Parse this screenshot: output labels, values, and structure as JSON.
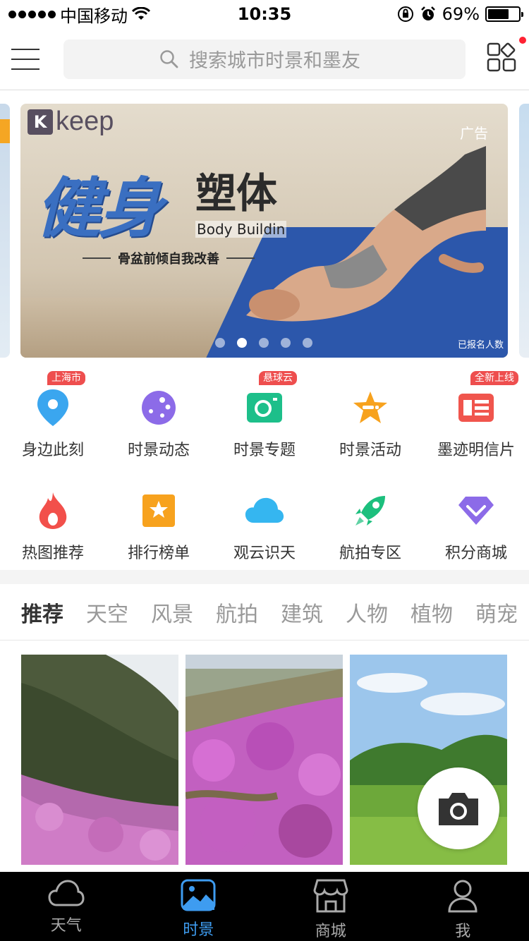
{
  "status_bar": {
    "carrier": "中国移动",
    "time": "10:35",
    "battery": "69%",
    "battery_level": 0.69
  },
  "header": {
    "search_placeholder": "搜索城市时景和墨友"
  },
  "banner": {
    "brand": "keep",
    "ad_tag": "广告",
    "headline_big": "健身",
    "headline_small": "塑体",
    "headline_en": "Body Buildin",
    "headline_sub": "骨盆前倾自我改善",
    "signup_text": "已报名人数",
    "page_count": 5,
    "active_page": 2
  },
  "features": [
    {
      "label": "身边此刻",
      "badge": "上海市",
      "icon": "location-pin-icon",
      "color": "#3aa6ef"
    },
    {
      "label": "时景动态",
      "badge": "",
      "icon": "palette-icon",
      "color": "#8c6be8"
    },
    {
      "label": "时景专题",
      "badge": "悬球云",
      "icon": "camera-square-icon",
      "color": "#1dbf8a"
    },
    {
      "label": "时景活动",
      "badge": "",
      "icon": "star-ticket-icon",
      "color": "#f7a21e"
    },
    {
      "label": "墨迹明信片",
      "badge": "全新上线",
      "icon": "postcard-icon",
      "color": "#f0554d"
    },
    {
      "label": "热图推荐",
      "badge": "",
      "icon": "flame-icon",
      "color": "#f2504b"
    },
    {
      "label": "排行榜单",
      "badge": "",
      "icon": "ranking-star-icon",
      "color": "#f7a21e"
    },
    {
      "label": "观云识天",
      "badge": "",
      "icon": "cloud-icon",
      "color": "#35b6f0"
    },
    {
      "label": "航拍专区",
      "badge": "",
      "icon": "rocket-icon",
      "color": "#1cbf7d"
    },
    {
      "label": "积分商城",
      "badge": "",
      "icon": "gem-icon",
      "color": "#8c6be8"
    }
  ],
  "categories": [
    "推荐",
    "天空",
    "风景",
    "航拍",
    "建筑",
    "人物",
    "植物",
    "萌宠"
  ],
  "active_category": 0,
  "tabbar": [
    {
      "label": "天气",
      "icon": "cloud-icon"
    },
    {
      "label": "时景",
      "icon": "photo-icon"
    },
    {
      "label": "商城",
      "icon": "store-icon"
    },
    {
      "label": "我",
      "icon": "user-icon"
    }
  ],
  "active_tab": 1,
  "colors": {
    "accent": "#3e9cf0",
    "badge": "#ee4e4e",
    "banner_blue": "#3a6fc1"
  }
}
